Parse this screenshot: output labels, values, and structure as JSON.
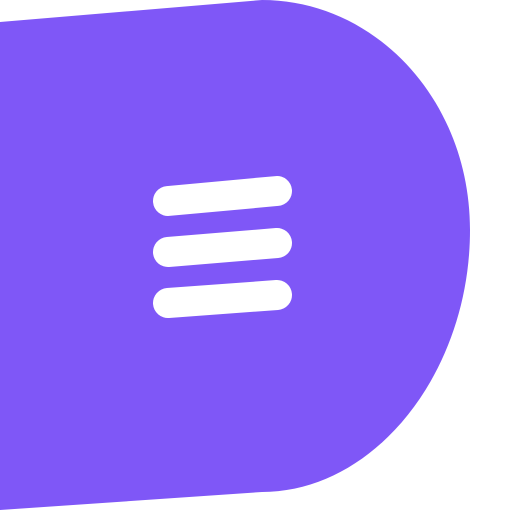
{
  "menu_button": {
    "icon": "hamburger-menu-icon",
    "background_color": "#7f57f7",
    "icon_color": "#ffffff"
  }
}
